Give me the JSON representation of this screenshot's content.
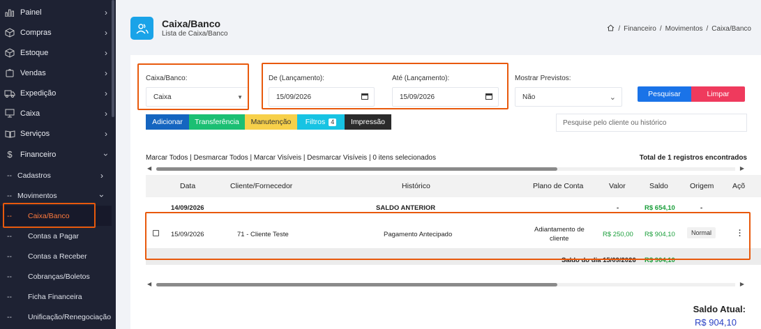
{
  "sidebar": {
    "items": [
      {
        "label": "Painel",
        "icon": "bar-chart-icon"
      },
      {
        "label": "Compras",
        "icon": "box-icon"
      },
      {
        "label": "Estoque",
        "icon": "box-icon"
      },
      {
        "label": "Vendas",
        "icon": "cart-icon"
      },
      {
        "label": "Expedição",
        "icon": "truck-icon"
      },
      {
        "label": "Caixa",
        "icon": "monitor-icon"
      },
      {
        "label": "Serviços",
        "icon": "book-icon"
      },
      {
        "label": "Financeiro",
        "icon": "dollar-icon"
      }
    ],
    "sub": [
      {
        "dash": "--",
        "label": "Cadastros"
      },
      {
        "dash": "--",
        "label": "Movimentos"
      }
    ],
    "sub2": [
      {
        "dash": "--",
        "label": "Caixa/Banco"
      },
      {
        "dash": "--",
        "label": "Contas a Pagar"
      },
      {
        "dash": "--",
        "label": "Contas a Receber"
      },
      {
        "dash": "--",
        "label": "Cobranças/Boletos"
      },
      {
        "dash": "--",
        "label": "Ficha Financeira"
      },
      {
        "dash": "--",
        "label": "Unificação/Renegociação"
      }
    ]
  },
  "header": {
    "title": "Caixa/Banco",
    "subtitle": "Lista de Caixa/Banco",
    "breadcrumb": [
      "Financeiro",
      "Movimentos",
      "Caixa/Banco"
    ],
    "sep": "/"
  },
  "filters": {
    "caixa_label": "Caixa/Banco:",
    "caixa_value": "Caixa",
    "de_label": "De (Lançamento):",
    "de_value": "15/09/2026",
    "ate_label": "Até (Lançamento):",
    "ate_value": "15/09/2026",
    "previstos_label": "Mostrar Previstos:",
    "previstos_value": "Não",
    "pesquisar": "Pesquisar",
    "limpar": "Limpar"
  },
  "toolbar": {
    "adicionar": "Adicionar",
    "transferencia": "Transferência",
    "manutencao": "Manutenção",
    "filtros": "Filtros",
    "filtros_count": "4",
    "impressao": "Impressão",
    "search_placeholder": "Pesquise pelo cliente ou histórico"
  },
  "selection": {
    "marcar_todos": "Marcar Todos",
    "desmarcar_todos": "Desmarcar Todos",
    "marcar_visiveis": "Marcar Visíveis",
    "desmarcar_visiveis": "Desmarcar Visíveis",
    "selecionados": "0 itens selecionados",
    "sep": " | ",
    "total": "Total de 1 registros encontrados"
  },
  "table": {
    "headers": [
      "Data",
      "Cliente/Fornecedor",
      "Histórico",
      "Plano de Conta",
      "Valor",
      "Saldo",
      "Origem",
      "Açõ"
    ],
    "anterior": {
      "data": "14/09/2026",
      "historico": "SALDO ANTERIOR",
      "valor": "-",
      "saldo": "R$ 654,10",
      "origem": "-"
    },
    "rows": [
      {
        "data": "15/09/2026",
        "cliente": "71 - Cliente Teste",
        "historico": "Pagamento Antecipado",
        "plano": "Adiantamento de cliente",
        "plano_l1": "Adiantamento de",
        "plano_l2": "cliente",
        "valor": "R$ 250,00",
        "saldo": "R$ 904,10",
        "origem": "Normal"
      }
    ],
    "saldo_dia_label": "Saldo do dia 15/09/2026",
    "saldo_dia_value": "R$ 904,10"
  },
  "footer": {
    "saldo_atual_label": "Saldo Atual:",
    "saldo_atual_value": "R$ 904,10"
  },
  "colors": {
    "accent": "#1aa3e8",
    "adicionar": "#1565c0",
    "transferencia": "#1bbf73",
    "manutencao": "#f7d04a",
    "filtros": "#17c3e3",
    "impressao": "#2b2b2b",
    "pesquisar": "#1a73e8",
    "limpar": "#ef3a5d",
    "highlight": "#e8590c"
  }
}
